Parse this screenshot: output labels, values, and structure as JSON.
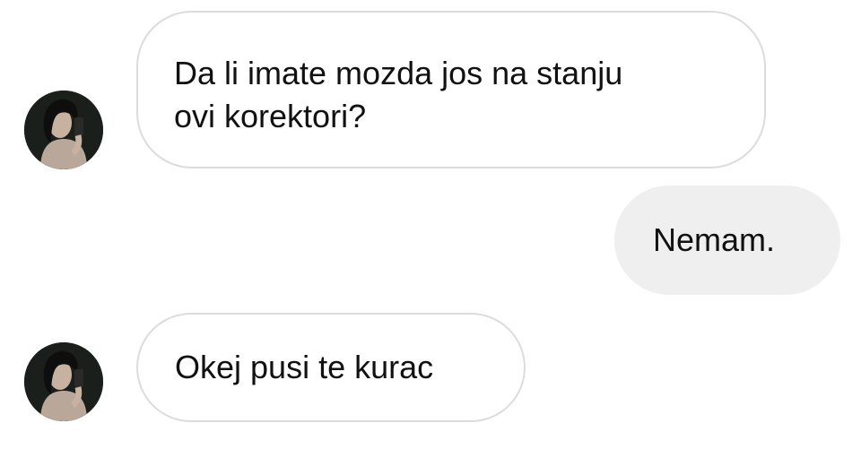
{
  "conversation": {
    "messages": [
      {
        "direction": "incoming",
        "text": "Da li imate mozda jos na stanju\novi korektori?"
      },
      {
        "direction": "outgoing",
        "text": "Nemam."
      },
      {
        "direction": "incoming",
        "text": "Okej pusi te kurac"
      }
    ]
  },
  "colors": {
    "incoming_bubble_bg": "#ffffff",
    "incoming_bubble_border": "#dcdcdc",
    "outgoing_bubble_bg": "#efefef",
    "text": "#111111"
  },
  "icons": {
    "avatar": "sender-avatar"
  }
}
